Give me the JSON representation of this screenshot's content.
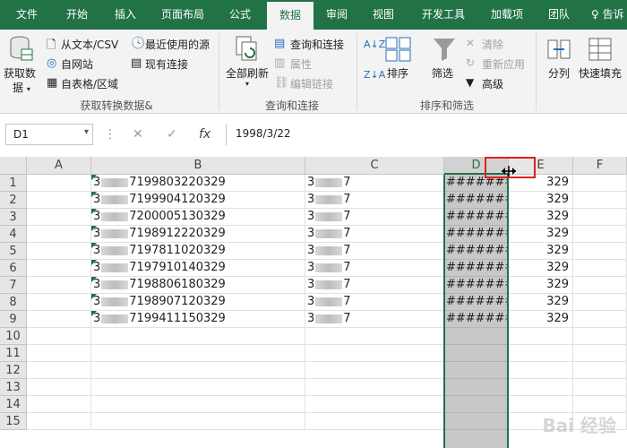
{
  "tabs": [
    "文件",
    "开始",
    "插入",
    "页面布局",
    "公式",
    "数据",
    "审阅",
    "视图",
    "开发工具",
    "加载项",
    "团队"
  ],
  "active_tab": "数据",
  "tell_me": "告诉",
  "ribbon": {
    "get_external": {
      "big": "获取数",
      "big2": "据",
      "from_text": "从文本/CSV",
      "from_web": "自网站",
      "from_table": "自表格/区域",
      "recent": "最近使用的源",
      "existing": "现有连接",
      "label": "获取转换数据&"
    },
    "queries": {
      "refresh": "全部刷新",
      "queries_conn": "查询和连接",
      "properties": "属性",
      "edit_links": "编辑链接",
      "label": "查询和连接"
    },
    "sort_filter": {
      "sort": "排序",
      "filter": "筛选",
      "clear": "清除",
      "reapply": "重新应用",
      "advanced": "高级",
      "label": "排序和筛选"
    },
    "tools": {
      "split": "分列",
      "flash_fill": "快速填充"
    }
  },
  "formula_bar": {
    "name_box": "D1",
    "fx": "fx",
    "value": "1998/3/22"
  },
  "columns": [
    "A",
    "B",
    "C",
    "D",
    "E",
    "F"
  ],
  "rows": [
    "1",
    "2",
    "3",
    "4",
    "5",
    "6",
    "7",
    "8",
    "9",
    "10",
    "11",
    "12",
    "13",
    "14",
    "15"
  ],
  "data_rows": [
    {
      "b_pre": "3",
      "b_suf": "7199803220329",
      "c_pre": "3",
      "c_suf": "7",
      "d": "#######",
      "e": "329"
    },
    {
      "b_pre": "3",
      "b_suf": "7199904120329",
      "c_pre": "3",
      "c_suf": "7",
      "d": "#######",
      "e": "329"
    },
    {
      "b_pre": "3",
      "b_suf": "7200005130329",
      "c_pre": "3",
      "c_suf": "7",
      "d": "#######",
      "e": "329"
    },
    {
      "b_pre": "3",
      "b_suf": "7198912220329",
      "c_pre": "3",
      "c_suf": "7",
      "d": "#######",
      "e": "329"
    },
    {
      "b_pre": "3",
      "b_suf": "7197811020329",
      "c_pre": "3",
      "c_suf": "7",
      "d": "#######",
      "e": "329"
    },
    {
      "b_pre": "3",
      "b_suf": "7197910140329",
      "c_pre": "3",
      "c_suf": "7",
      "d": "#######",
      "e": "329"
    },
    {
      "b_pre": "3",
      "b_suf": "7198806180329",
      "c_pre": "3",
      "c_suf": "7",
      "d": "#######",
      "e": "329"
    },
    {
      "b_pre": "3",
      "b_suf": "7198907120329",
      "c_pre": "3",
      "c_suf": "7",
      "d": "#######",
      "e": "329"
    },
    {
      "b_pre": "3",
      "b_suf": "7199411150329",
      "c_pre": "3",
      "c_suf": "7",
      "d": "#######",
      "e": "329"
    }
  ],
  "watermark": "Bai 经验",
  "colors": {
    "accent": "#217346",
    "highlight": "#e02020"
  }
}
